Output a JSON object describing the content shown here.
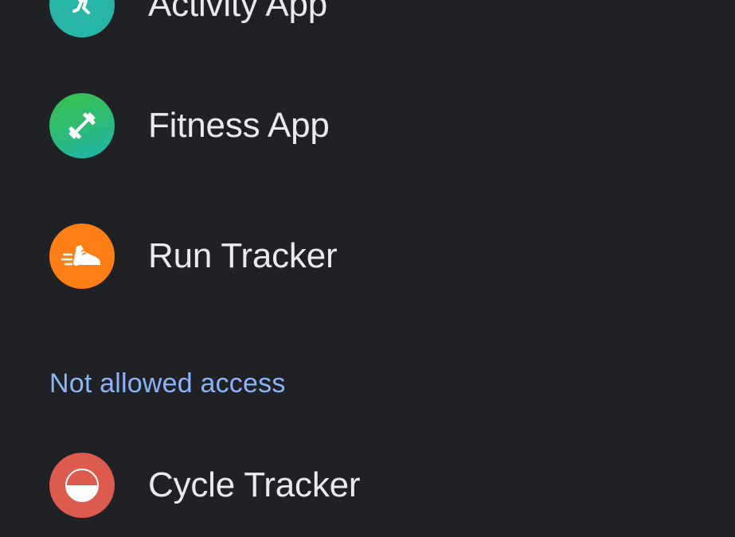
{
  "allowed_apps": [
    {
      "label": "Activity App",
      "icon": "running-figure-icon",
      "color": "#26b5a6"
    },
    {
      "label": "Fitness App",
      "icon": "dumbbell-icon",
      "color_top": "#3cc14b",
      "color_bottom": "#20b3b3"
    },
    {
      "label": "Run Tracker",
      "icon": "running-shoe-icon",
      "color": "#ff7f17"
    }
  ],
  "not_allowed_section": {
    "header": "Not allowed access"
  },
  "not_allowed_apps": [
    {
      "label": "Cycle Tracker",
      "icon": "half-circle-icon",
      "color": "#dc5a4e"
    }
  ],
  "colors": {
    "background": "#202124",
    "text": "#e8eaed",
    "accent": "#8ab4f8"
  }
}
